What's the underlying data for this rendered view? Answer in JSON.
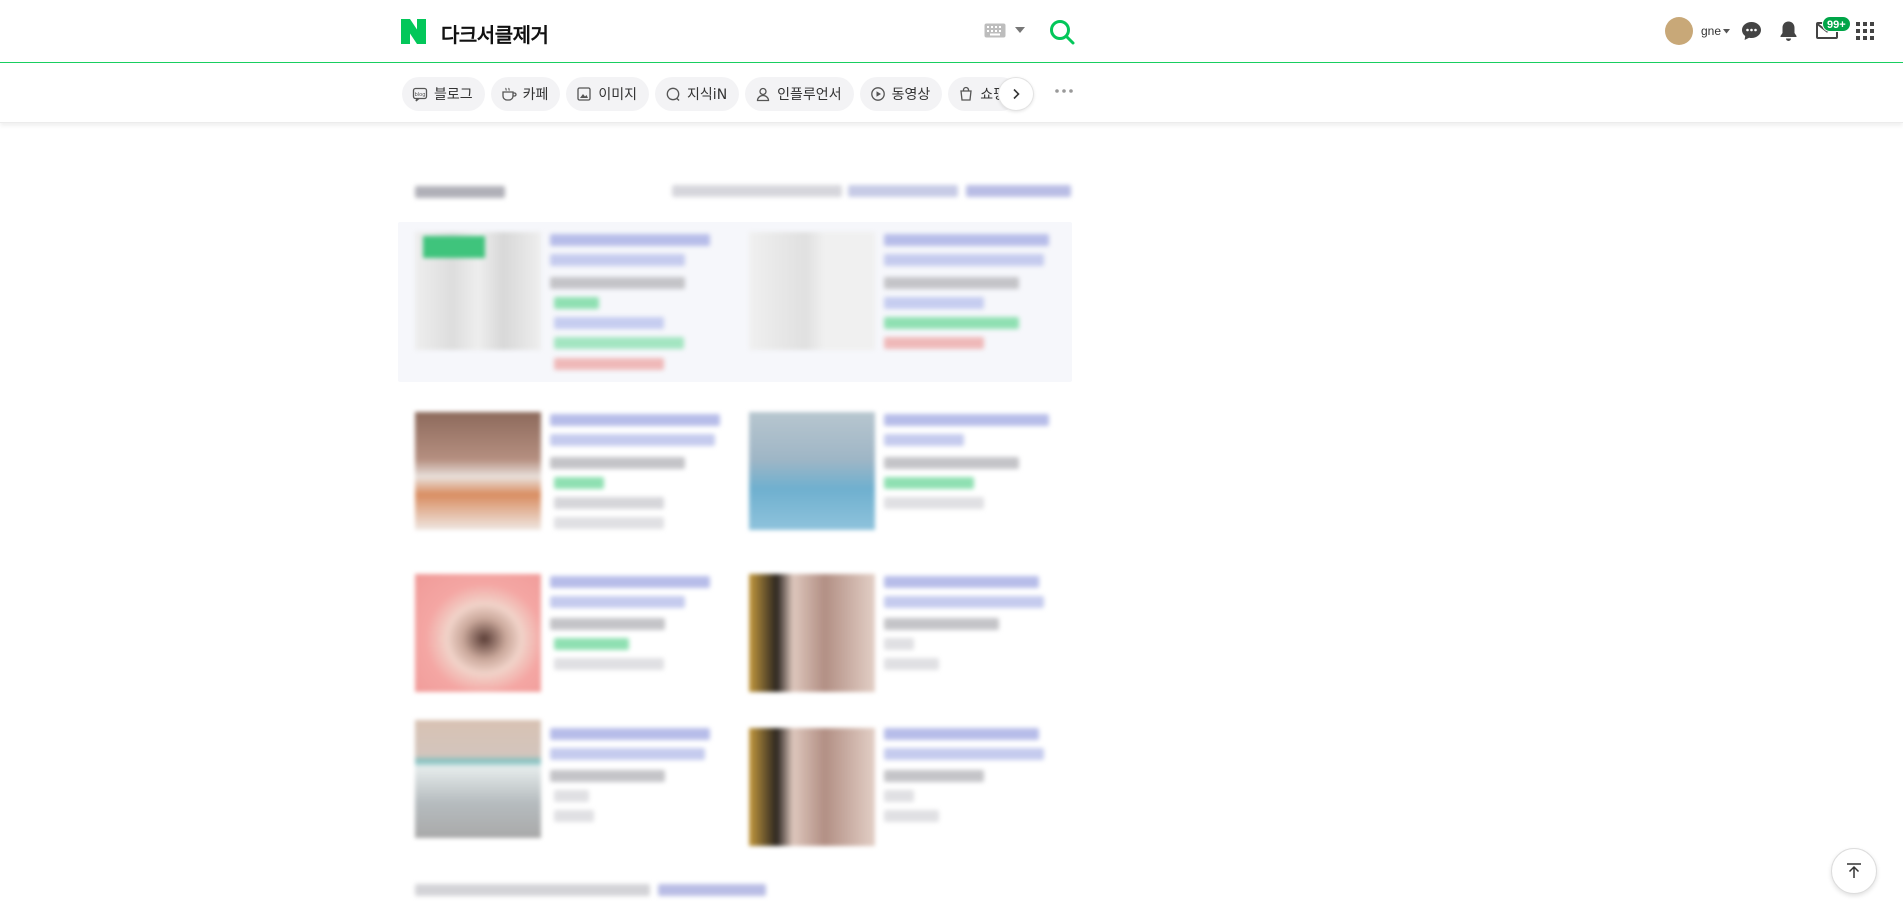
{
  "header": {
    "query": "다크서클제거",
    "username": "gne",
    "mail_badge": "99+"
  },
  "tabs": [
    {
      "label": "블로그",
      "icon": "blog-icon"
    },
    {
      "label": "카페",
      "icon": "cafe-icon"
    },
    {
      "label": "이미지",
      "icon": "image-icon"
    },
    {
      "label": "지식iN",
      "icon": "kin-icon"
    },
    {
      "label": "인플루언서",
      "icon": "influencer-icon"
    },
    {
      "label": "동영상",
      "icon": "video-icon"
    },
    {
      "label": "쇼핑",
      "icon": "shopping-icon"
    }
  ],
  "colors": {
    "brand_green": "#03c75a",
    "header_line": "#19ce60",
    "badge_green": "#00a548"
  }
}
